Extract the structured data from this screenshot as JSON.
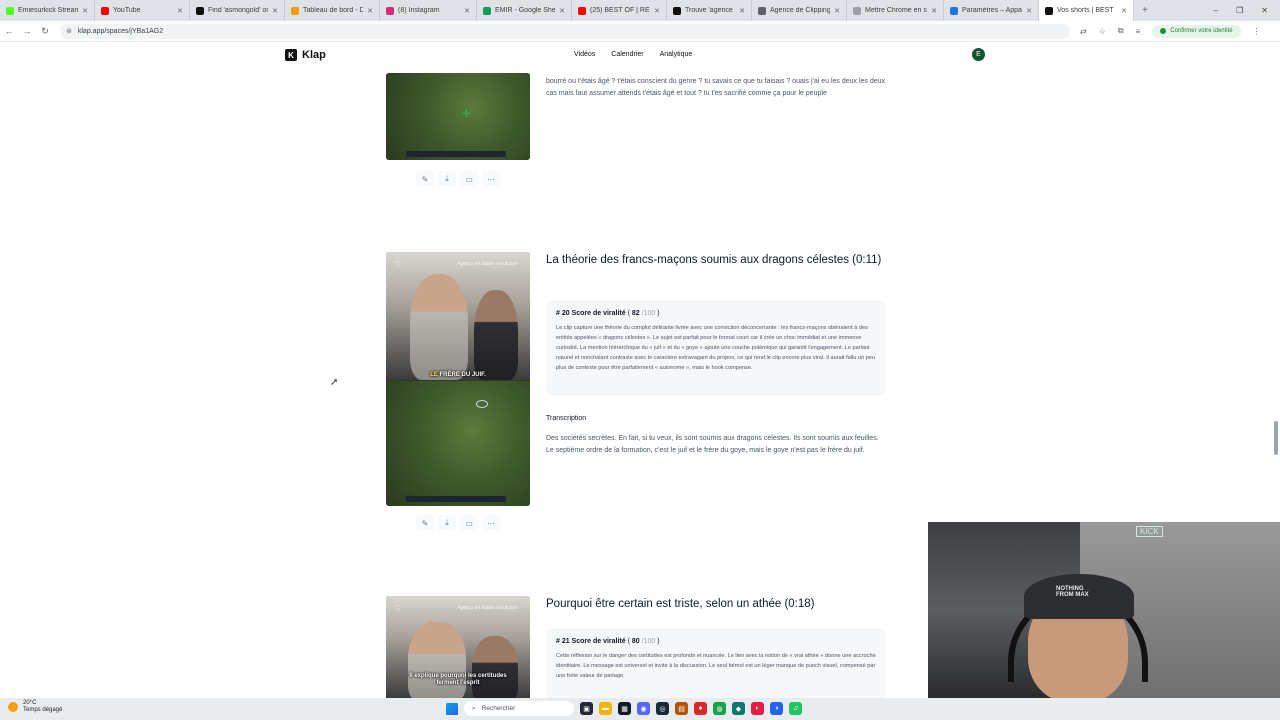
{
  "browser": {
    "tabs": [
      {
        "title": "Emiesurkick Stream - W",
        "color": "#53fc18"
      },
      {
        "title": "YouTube",
        "color": "#ff0000"
      },
      {
        "title": "Find 'asmongold' on T",
        "color": "#111111"
      },
      {
        "title": "Tableau de bord - Dor",
        "color": "#f59e0b"
      },
      {
        "title": "(8) Instagram",
        "color": "#d62976"
      },
      {
        "title": "EMIR - Google Sheets",
        "color": "#0f9d58"
      },
      {
        "title": "(25) BEST OF | REDIFF",
        "color": "#ff0000"
      },
      {
        "title": "Trouve 'agence clippi",
        "color": "#111111"
      },
      {
        "title": "Agence de Clipping Ti",
        "color": "#5f6368"
      },
      {
        "title": "Mettre Chrome en sor",
        "color": "#9aa0a6"
      },
      {
        "title": "Paramètres – Appare",
        "color": "#1a73e8"
      },
      {
        "title": "Vos shorts | BEST",
        "color": "#111111",
        "active": true
      }
    ],
    "new_tab": "+",
    "window_controls": [
      "–",
      "❐",
      "✕"
    ],
    "url": "klap.app/spaces/jYBa1AG2",
    "confirm_identity": "Confirmer votre identité"
  },
  "app": {
    "logo": "Klap",
    "nav": [
      "Vidéos",
      "Calendrier",
      "Analytique"
    ],
    "avatar_initial": "E"
  },
  "clip_prev": {
    "transcript": "bourré ou t'étais âgé ? t'étais conscient du genre ? tu savais ce que tu faisais ? ouais j'ai eu les deux les deux cas mais faut assumer attends t'étais âgé et tout ? tu t'es sacrifié comme ça pour le peuple"
  },
  "clip_20": {
    "quality": "Aperçu en basse résolution",
    "caption_hl": "LE",
    "caption_rest": " FRÈRE DU JUIF.",
    "title": "La théorie des francs-maçons soumis aux dragons célestes (0:11)",
    "score_label": "# 20 Score de viralité",
    "score": "82",
    "score_max": "/100",
    "score_text": "Le clip capture une théorie du complot délirante livrée avec une conviction déconcertante : les francs-maçons obéiraient à des entités appelées « dragons célestes ». Le sujet est parfait pour le format court car il crée un choc immédiat et une immense curiosité. La mention hiérarchique du « juif » et du « goye » ajoute une couche polémique qui garantit l'engagement. Le parlant naturel et nonchalant contraste avec le caractère extravagant du propos, ce qui rend le clip encore plus viral. Il aurait fallu un peu plus de contexte pour être parfaitement « autonome », mais le hook compense.",
    "transcription_label": "Transcription",
    "transcript": "Des sociétés secrètes. En fait, si tu veux, ils sont soumis aux dragons célestes. Ils sont soumis aux feuilles. Le septième ordre de la formation, c'est le juif et le frère du goye, mais le goye n'est pas le frère du juif."
  },
  "clip_21": {
    "quality": "Aperçu en basse résolution",
    "caption": "Il explique pourquoi les certitudes ferment l'esprit",
    "title": "Pourquoi être certain est triste, selon un athée (0:18)",
    "score_label": "# 21 Score de viralité",
    "score": "80",
    "score_max": "/100",
    "score_text": "Cette réflexion sur le danger des certitudes est profonde et nuancée. Le lien avec la notion de « vrai athée » donne une accroche identitaire. Le message est universel et invite à la discussion. Le seul bémol est un léger manque de punch visuel, compensé par une forte valeur de partage."
  },
  "webcam": {
    "cap_text": "NOTHING FROM MAX",
    "sign_text": "KICK"
  },
  "taskbar": {
    "temperature": "20°C",
    "weather": "Temps dégagé",
    "search_placeholder": "Rechercher"
  }
}
